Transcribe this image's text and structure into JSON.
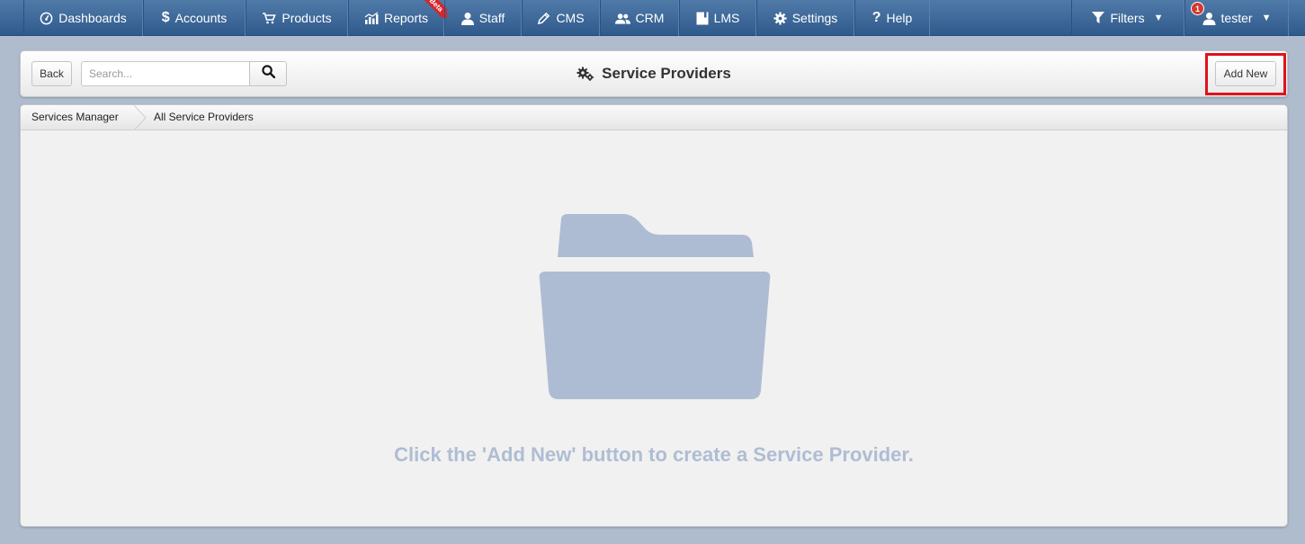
{
  "nav": {
    "left": [
      {
        "key": "dashboards",
        "label": "Dashboards",
        "icon": "dashboard-icon"
      },
      {
        "key": "accounts",
        "label": "Accounts",
        "icon": "dollar-icon"
      },
      {
        "key": "products",
        "label": "Products",
        "icon": "cart-icon"
      },
      {
        "key": "reports",
        "label": "Reports",
        "icon": "chart-icon",
        "ribbon": "Beta"
      },
      {
        "key": "staff",
        "label": "Staff",
        "icon": "user-icon"
      },
      {
        "key": "cms",
        "label": "CMS",
        "icon": "pencil-icon"
      },
      {
        "key": "crm",
        "label": "CRM",
        "icon": "users-icon"
      },
      {
        "key": "lms",
        "label": "LMS",
        "icon": "book-icon"
      },
      {
        "key": "settings",
        "label": "Settings",
        "icon": "gear-icon"
      },
      {
        "key": "help",
        "label": "Help",
        "icon": "question-icon"
      }
    ],
    "filters": {
      "label": "Filters",
      "icon": "filter-icon"
    },
    "user": {
      "label": "tester",
      "icon": "user-icon",
      "badge": "1"
    }
  },
  "header": {
    "back_label": "Back",
    "search_placeholder": "Search...",
    "title": "Service Providers",
    "add_label": "Add New"
  },
  "breadcrumb": {
    "items": [
      "Services Manager",
      "All Service Providers"
    ]
  },
  "empty_state": {
    "message": "Click the 'Add New' button to create a Service Provider.",
    "icon": "folder-icon"
  },
  "colors": {
    "nav_bg": "#3a6597",
    "page_bg": "#aebccd",
    "highlight": "#e0121c",
    "empty_text": "#afbdd3"
  }
}
